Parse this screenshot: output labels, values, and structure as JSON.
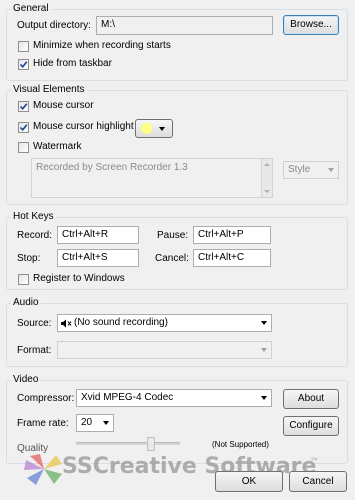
{
  "general": {
    "title": "General",
    "output_label": "Output directory:",
    "output_value": "M:\\",
    "browse_label": "Browse...",
    "minimize_label": "Minimize when recording starts",
    "minimize_checked": false,
    "hide_label": "Hide from taskbar",
    "hide_checked": true
  },
  "visual": {
    "title": "Visual Elements",
    "cursor_label": "Mouse cursor",
    "cursor_checked": true,
    "highlight_label": "Mouse cursor highlight",
    "highlight_checked": true,
    "highlight_color": "#ffff80",
    "watermark_label": "Watermark",
    "watermark_checked": false,
    "watermark_text": "Recorded by Screen Recorder 1.3",
    "style_value": "Style"
  },
  "hotkeys": {
    "title": "Hot Keys",
    "record_label": "Record:",
    "record_value": "Ctrl+Alt+R",
    "pause_label": "Pause:",
    "pause_value": "Ctrl+Alt+P",
    "stop_label": "Stop:",
    "stop_value": "Ctrl+Alt+S",
    "cancel_label": "Cancel:",
    "cancel_value": "Ctrl+Alt+C",
    "register_label": "Register to Windows",
    "register_checked": false
  },
  "audio": {
    "title": "Audio",
    "source_label": "Source:",
    "source_value": "(No sound recording)",
    "source_icon": "muted-speaker-icon",
    "format_label": "Format:",
    "format_value": ""
  },
  "video": {
    "title": "Video",
    "compressor_label": "Compressor:",
    "compressor_value": "Xvid MPEG-4 Codec",
    "about_label": "About",
    "framerate_label": "Frame rate:",
    "framerate_value": "20",
    "configure_label": "Configure",
    "quality_label": "Quality",
    "quality_note": "(Not Supported)"
  },
  "watermark_logo": {
    "text": "SSCreative Software",
    "tm": "™"
  },
  "footer": {
    "ok_label": "OK",
    "cancel_label": "Cancel"
  }
}
